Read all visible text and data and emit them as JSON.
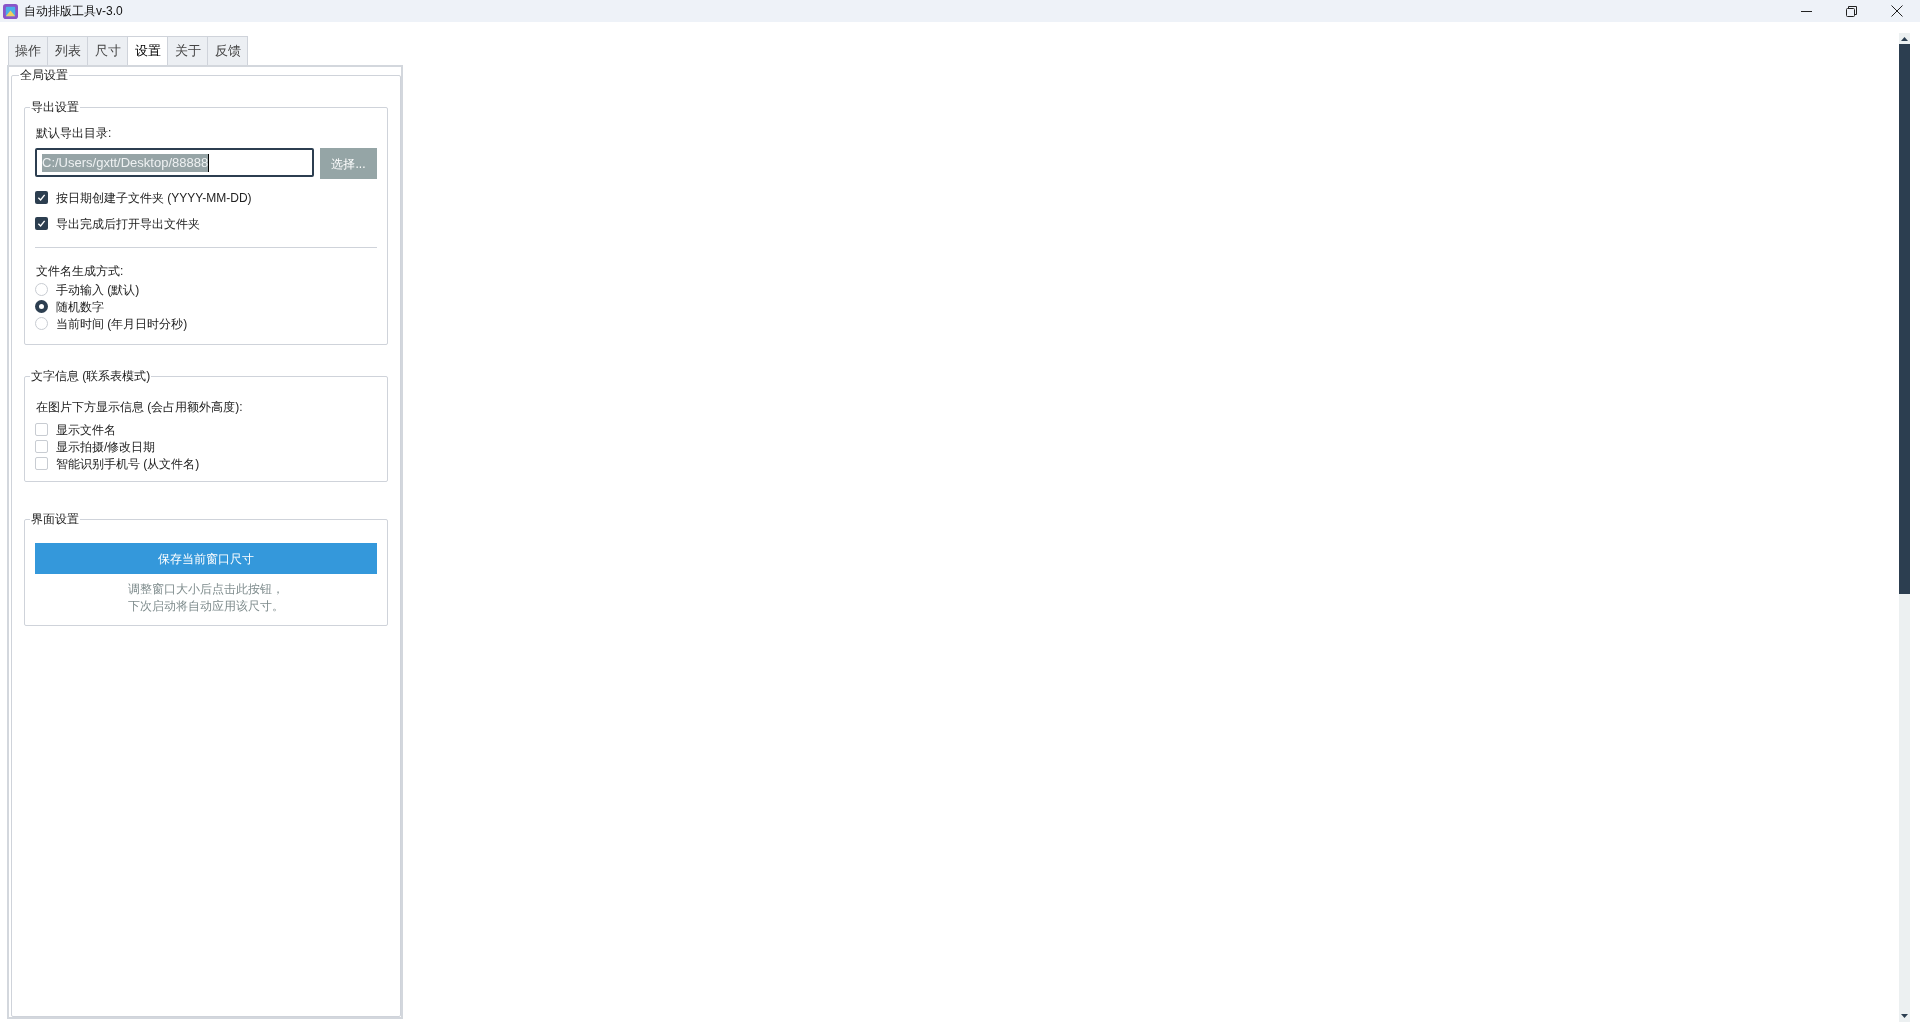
{
  "window": {
    "title": "自动排版工具v-3.0"
  },
  "tabs": [
    {
      "label": "操作",
      "selected": false
    },
    {
      "label": "列表",
      "selected": false
    },
    {
      "label": "尺寸",
      "selected": false
    },
    {
      "label": "设置",
      "selected": true
    },
    {
      "label": "关于",
      "selected": false
    },
    {
      "label": "反馈",
      "selected": false
    }
  ],
  "global_settings": {
    "title": "全局设置",
    "export_settings": {
      "title": "导出设置",
      "dir_label": "默认导出目录:",
      "dir_value": "C:/Users/gxtt/Desktop/88888",
      "choose_button": "选择...",
      "options": [
        {
          "label": "按日期创建子文件夹 (YYYY-MM-DD)",
          "checked": true
        },
        {
          "label": "导出完成后打开导出文件夹",
          "checked": true
        }
      ],
      "naming_label": "文件名生成方式:",
      "naming_options": [
        {
          "label": "手动输入 (默认)",
          "selected": false
        },
        {
          "label": "随机数字",
          "selected": true
        },
        {
          "label": "当前时间 (年月日时分秒)",
          "selected": false
        }
      ]
    },
    "text_info": {
      "title": "文字信息 (联系表模式)",
      "hint": "在图片下方显示信息 (会占用额外高度):",
      "options": [
        {
          "label": "显示文件名",
          "checked": false
        },
        {
          "label": "显示拍摄/修改日期",
          "checked": false
        },
        {
          "label": "智能识别手机号 (从文件名)",
          "checked": false
        }
      ]
    },
    "ui_settings": {
      "title": "界面设置",
      "save_button": "保存当前窗口尺寸",
      "notes": [
        "调整窗口大小后点击此按钮，",
        "下次启动将自动应用该尺寸。"
      ]
    }
  }
}
